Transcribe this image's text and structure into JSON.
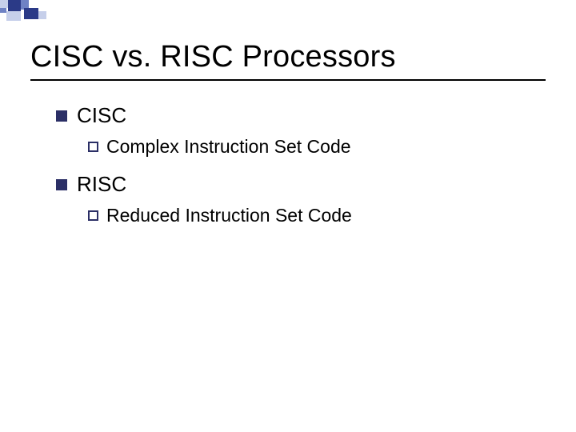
{
  "title": "CISC vs. RISC Processors",
  "items": [
    {
      "label": "CISC",
      "sub": "Complex Instruction Set Code"
    },
    {
      "label": "RISC",
      "sub": "Reduced Instruction Set Code"
    }
  ],
  "deco_colors": {
    "dark": "#2b3a87",
    "mid": "#6f82c4",
    "light": "#c6cfea"
  }
}
